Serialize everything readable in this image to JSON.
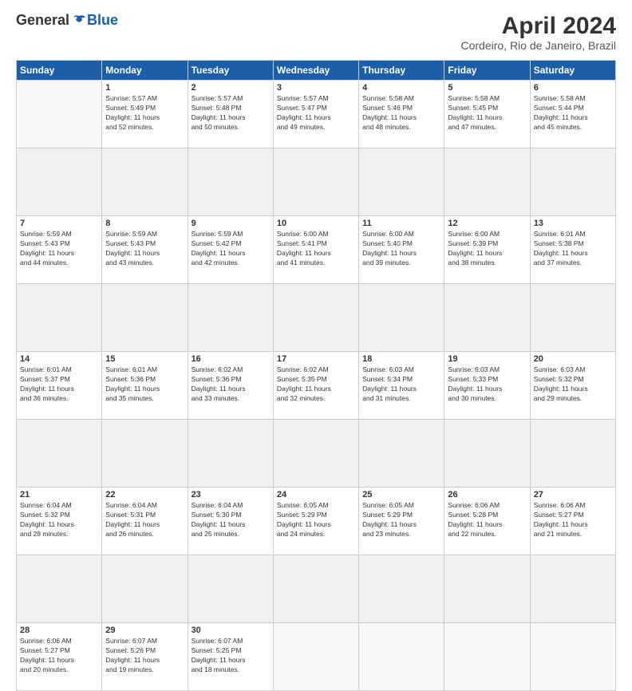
{
  "header": {
    "logo_general": "General",
    "logo_blue": "Blue",
    "title": "April 2024",
    "subtitle": "Cordeiro, Rio de Janeiro, Brazil"
  },
  "weekdays": [
    "Sunday",
    "Monday",
    "Tuesday",
    "Wednesday",
    "Thursday",
    "Friday",
    "Saturday"
  ],
  "weeks": [
    [
      {
        "day": "",
        "sunrise": "",
        "sunset": "",
        "daylight": ""
      },
      {
        "day": "1",
        "sunrise": "Sunrise: 5:57 AM",
        "sunset": "Sunset: 5:49 PM",
        "daylight": "Daylight: 11 hours and 52 minutes."
      },
      {
        "day": "2",
        "sunrise": "Sunrise: 5:57 AM",
        "sunset": "Sunset: 5:48 PM",
        "daylight": "Daylight: 11 hours and 50 minutes."
      },
      {
        "day": "3",
        "sunrise": "Sunrise: 5:57 AM",
        "sunset": "Sunset: 5:47 PM",
        "daylight": "Daylight: 11 hours and 49 minutes."
      },
      {
        "day": "4",
        "sunrise": "Sunrise: 5:58 AM",
        "sunset": "Sunset: 5:46 PM",
        "daylight": "Daylight: 11 hours and 48 minutes."
      },
      {
        "day": "5",
        "sunrise": "Sunrise: 5:58 AM",
        "sunset": "Sunset: 5:45 PM",
        "daylight": "Daylight: 11 hours and 47 minutes."
      },
      {
        "day": "6",
        "sunrise": "Sunrise: 5:58 AM",
        "sunset": "Sunset: 5:44 PM",
        "daylight": "Daylight: 11 hours and 45 minutes."
      }
    ],
    [
      {
        "day": "7",
        "sunrise": "Sunrise: 5:59 AM",
        "sunset": "Sunset: 5:43 PM",
        "daylight": "Daylight: 11 hours and 44 minutes."
      },
      {
        "day": "8",
        "sunrise": "Sunrise: 5:59 AM",
        "sunset": "Sunset: 5:43 PM",
        "daylight": "Daylight: 11 hours and 43 minutes."
      },
      {
        "day": "9",
        "sunrise": "Sunrise: 5:59 AM",
        "sunset": "Sunset: 5:42 PM",
        "daylight": "Daylight: 11 hours and 42 minutes."
      },
      {
        "day": "10",
        "sunrise": "Sunrise: 6:00 AM",
        "sunset": "Sunset: 5:41 PM",
        "daylight": "Daylight: 11 hours and 41 minutes."
      },
      {
        "day": "11",
        "sunrise": "Sunrise: 6:00 AM",
        "sunset": "Sunset: 5:40 PM",
        "daylight": "Daylight: 11 hours and 39 minutes."
      },
      {
        "day": "12",
        "sunrise": "Sunrise: 6:00 AM",
        "sunset": "Sunset: 5:39 PM",
        "daylight": "Daylight: 11 hours and 38 minutes."
      },
      {
        "day": "13",
        "sunrise": "Sunrise: 6:01 AM",
        "sunset": "Sunset: 5:38 PM",
        "daylight": "Daylight: 11 hours and 37 minutes."
      }
    ],
    [
      {
        "day": "14",
        "sunrise": "Sunrise: 6:01 AM",
        "sunset": "Sunset: 5:37 PM",
        "daylight": "Daylight: 11 hours and 36 minutes."
      },
      {
        "day": "15",
        "sunrise": "Sunrise: 6:01 AM",
        "sunset": "Sunset: 5:36 PM",
        "daylight": "Daylight: 11 hours and 35 minutes."
      },
      {
        "day": "16",
        "sunrise": "Sunrise: 6:02 AM",
        "sunset": "Sunset: 5:36 PM",
        "daylight": "Daylight: 11 hours and 33 minutes."
      },
      {
        "day": "17",
        "sunrise": "Sunrise: 6:02 AM",
        "sunset": "Sunset: 5:35 PM",
        "daylight": "Daylight: 11 hours and 32 minutes."
      },
      {
        "day": "18",
        "sunrise": "Sunrise: 6:03 AM",
        "sunset": "Sunset: 5:34 PM",
        "daylight": "Daylight: 11 hours and 31 minutes."
      },
      {
        "day": "19",
        "sunrise": "Sunrise: 6:03 AM",
        "sunset": "Sunset: 5:33 PM",
        "daylight": "Daylight: 11 hours and 30 minutes."
      },
      {
        "day": "20",
        "sunrise": "Sunrise: 6:03 AM",
        "sunset": "Sunset: 5:32 PM",
        "daylight": "Daylight: 11 hours and 29 minutes."
      }
    ],
    [
      {
        "day": "21",
        "sunrise": "Sunrise: 6:04 AM",
        "sunset": "Sunset: 5:32 PM",
        "daylight": "Daylight: 11 hours and 28 minutes."
      },
      {
        "day": "22",
        "sunrise": "Sunrise: 6:04 AM",
        "sunset": "Sunset: 5:31 PM",
        "daylight": "Daylight: 11 hours and 26 minutes."
      },
      {
        "day": "23",
        "sunrise": "Sunrise: 6:04 AM",
        "sunset": "Sunset: 5:30 PM",
        "daylight": "Daylight: 11 hours and 25 minutes."
      },
      {
        "day": "24",
        "sunrise": "Sunrise: 6:05 AM",
        "sunset": "Sunset: 5:29 PM",
        "daylight": "Daylight: 11 hours and 24 minutes."
      },
      {
        "day": "25",
        "sunrise": "Sunrise: 6:05 AM",
        "sunset": "Sunset: 5:29 PM",
        "daylight": "Daylight: 11 hours and 23 minutes."
      },
      {
        "day": "26",
        "sunrise": "Sunrise: 6:06 AM",
        "sunset": "Sunset: 5:28 PM",
        "daylight": "Daylight: 11 hours and 22 minutes."
      },
      {
        "day": "27",
        "sunrise": "Sunrise: 6:06 AM",
        "sunset": "Sunset: 5:27 PM",
        "daylight": "Daylight: 11 hours and 21 minutes."
      }
    ],
    [
      {
        "day": "28",
        "sunrise": "Sunrise: 6:06 AM",
        "sunset": "Sunset: 5:27 PM",
        "daylight": "Daylight: 11 hours and 20 minutes."
      },
      {
        "day": "29",
        "sunrise": "Sunrise: 6:07 AM",
        "sunset": "Sunset: 5:26 PM",
        "daylight": "Daylight: 11 hours and 19 minutes."
      },
      {
        "day": "30",
        "sunrise": "Sunrise: 6:07 AM",
        "sunset": "Sunset: 5:25 PM",
        "daylight": "Daylight: 11 hours and 18 minutes."
      },
      {
        "day": "",
        "sunrise": "",
        "sunset": "",
        "daylight": ""
      },
      {
        "day": "",
        "sunrise": "",
        "sunset": "",
        "daylight": ""
      },
      {
        "day": "",
        "sunrise": "",
        "sunset": "",
        "daylight": ""
      },
      {
        "day": "",
        "sunrise": "",
        "sunset": "",
        "daylight": ""
      }
    ]
  ]
}
